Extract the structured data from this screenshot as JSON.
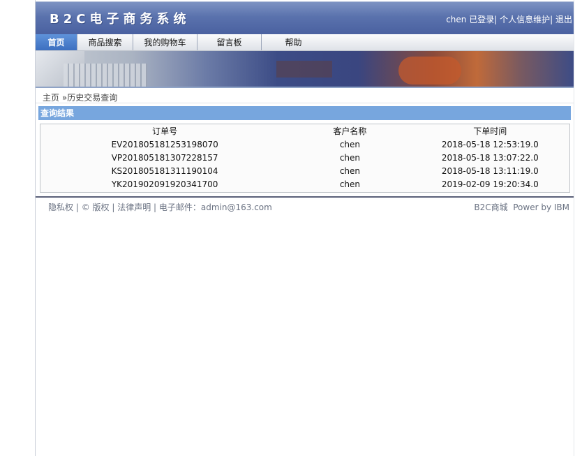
{
  "header": {
    "title": "B2C电子商务系统",
    "user_status": "chen 已登录",
    "sep1": "|",
    "profile_link": "个人信息维护",
    "sep2": "|",
    "logout_link": "退出"
  },
  "nav": {
    "tabs": [
      {
        "label": "首页"
      },
      {
        "label": "商品搜索"
      },
      {
        "label": "我的购物车"
      },
      {
        "label": "留言板"
      },
      {
        "label": "帮助"
      }
    ]
  },
  "breadcrumb": {
    "home": "主页",
    "separator": "»",
    "current": "历史交易查询"
  },
  "results": {
    "section_title": "查询结果",
    "columns": [
      "订单号",
      "客户名称",
      "下单时间"
    ],
    "rows": [
      [
        "EV20180518125319807​0",
        "chen",
        "2018-05-18 12:53:19.0"
      ],
      [
        "VP201805181307228157",
        "chen",
        "2018-05-18 13:07:22.0"
      ],
      [
        "KS201805181311190104",
        "chen",
        "2018-05-18 13:11:19.0"
      ],
      [
        "YK201902091920341700",
        "chen",
        "2019-02-09 19:20:34.0"
      ]
    ]
  },
  "footer": {
    "privacy": "隐私权",
    "sep1": " | ",
    "copyright": "© 版权",
    "sep2": " | ",
    "legal": "法律声明",
    "sep3": " | ",
    "email": "电子邮件：admin@163.com",
    "brand": "B2C商城",
    "powered": "Power by IBM"
  },
  "colors": {
    "header_blue": "#5a72ad",
    "section_head": "#77a6de",
    "active_tab": "#3d6fc0"
  }
}
